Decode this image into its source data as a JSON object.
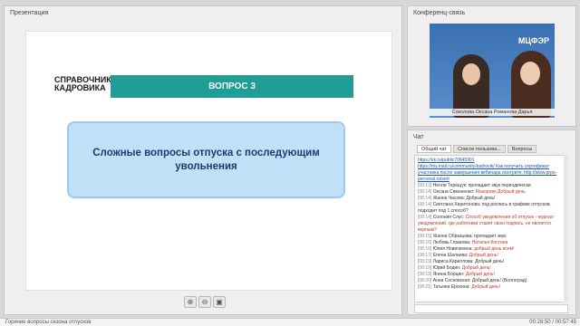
{
  "presentation": {
    "title": "Презентация",
    "slide": {
      "brand_line1": "СПРАВОЧНИК",
      "brand_line2": "КАДРОВИКА",
      "question_label": "ВОПРОС 3",
      "question_text": "Сложные вопросы отпуска с последующим увольнения"
    },
    "toolbar": {
      "zoom_in_icon": "zoom-in-icon",
      "zoom_out_icon": "zoom-out-icon",
      "save_icon": "save-icon"
    }
  },
  "conference": {
    "title": "Конференц-связь",
    "logo": "МЦФЭР",
    "caption": "Соколова Оксана Романова Дарья"
  },
  "chat": {
    "title": "Чат",
    "tabs": [
      "Общий чат",
      "Список пользова...",
      "Вопросы"
    ],
    "messages": [
      {
        "time": "",
        "author": "",
        "text": "https://vk.ru/public70645901",
        "link": true
      },
      {
        "time": "",
        "author": "",
        "text": "https://my.mail.ru/community/kadrovik/ Как получить сертификат участника после завершения вебинара смотрите: http://www.prpo-personal.ru/sert",
        "link": true
      },
      {
        "time": "[08:13]",
        "author": "Нелли Терещук:",
        "text": "пропадает звук переодически",
        "red": false
      },
      {
        "time": "[08:14]",
        "author": "Оксана Симоненко:",
        "text": "Макорова Добрый день",
        "red": true
      },
      {
        "time": "[08:14]",
        "author": "Жанна Часова:",
        "text": "Добрый день!",
        "red": false
      },
      {
        "time": "[08:14]",
        "author": "Светлана Харитонова:",
        "text": "под роспись в графике отпусков подходит под 1 способ?",
        "red": false
      },
      {
        "time": "[08:14]",
        "author": "Солония Слус:",
        "text": "Способ уведомления об отпуске - журнал уведомлений, где работники ставят свою подпись, не является верным?",
        "red": true
      },
      {
        "time": "[08:15]",
        "author": "Жанна Образцова:",
        "text": "пропадает звук",
        "red": false
      },
      {
        "time": "[08:16]",
        "author": "Любовь Глазкова:",
        "text": "Наталья Костина",
        "red": true
      },
      {
        "time": "[08:16]",
        "author": "Юлия Новичихина:",
        "text": "добрый день всем!",
        "red": true
      },
      {
        "time": "[08:17]",
        "author": "Елена Шалаева:",
        "text": "Добрый день!",
        "red": true
      },
      {
        "time": "[08:19]",
        "author": "Лариса Кириллова:",
        "text": "Добрый день!",
        "red": false
      },
      {
        "time": "[08:19]",
        "author": "Юрий Бодин:",
        "text": "Добрый день!",
        "red": true
      },
      {
        "time": "[08:19]",
        "author": "Янина Борцин:",
        "text": "Добрый день!",
        "red": true
      },
      {
        "time": "[08:20]",
        "author": "Анна Сосновская:",
        "text": "Добрый день! (Волгоград)",
        "red": false
      },
      {
        "time": "[08:21]",
        "author": "Татьяна Ерохина:",
        "text": "Добрый день!",
        "red": true
      }
    ]
  },
  "statusbar": {
    "title": "Горячие вопросы сезона отпусков",
    "time": "00:28:50 / 00:57:45"
  }
}
